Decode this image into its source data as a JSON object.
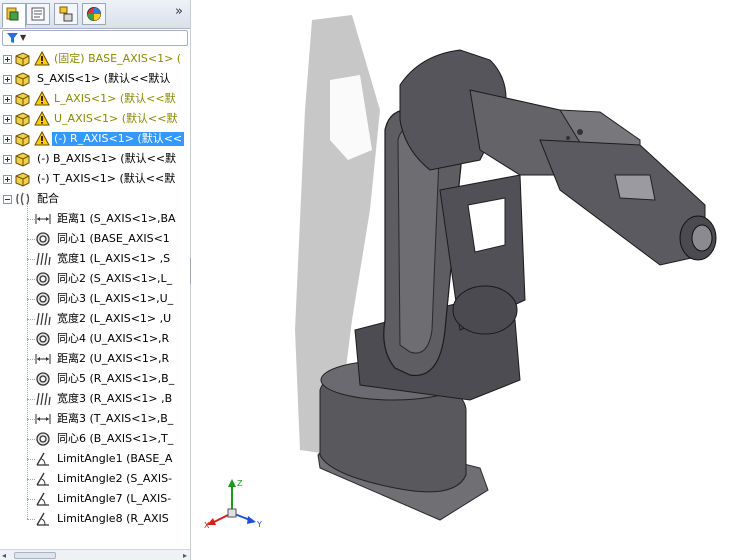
{
  "panel": {
    "tabs": [
      {
        "name": "featuremanager-tab",
        "icon": "featuremanager-tree-icon"
      },
      {
        "name": "propertymanager-tab",
        "icon": "property-sheet-icon"
      },
      {
        "name": "configurationmanager-tab",
        "icon": "configuration-icon"
      },
      {
        "name": "appearance-tab",
        "icon": "display-manager-icon"
      }
    ],
    "collapse_label": "»"
  },
  "tree": {
    "components": [
      {
        "label": "(固定) BASE_AXIS<1> (",
        "style": "olive",
        "selected": false
      },
      {
        "label": "S_AXIS<1> (默认<<默认",
        "style": "normal",
        "selected": false
      },
      {
        "label": "L_AXIS<1> (默认<<默",
        "style": "olive",
        "selected": false
      },
      {
        "label": "U_AXIS<1> (默认<<默",
        "style": "olive",
        "selected": false
      },
      {
        "label": "(-) R_AXIS<1> (默认<<",
        "style": "selected",
        "selected": true
      },
      {
        "label": "(-) B_AXIS<1> (默认<<默",
        "style": "normal",
        "selected": false
      },
      {
        "label": "(-) T_AXIS<1> (默认<<默",
        "style": "normal",
        "selected": false
      }
    ],
    "mates_folder": {
      "label": "配合"
    },
    "mates": [
      {
        "icon": "distance-mate-icon",
        "label": "距离1 (S_AXIS<1>,BA"
      },
      {
        "icon": "concentric-mate-icon",
        "label": "同心1 (BASE_AXIS<1"
      },
      {
        "icon": "width-mate-icon",
        "label": "宽度1 (L_AXIS<1> ,S"
      },
      {
        "icon": "concentric-mate-icon",
        "label": "同心2 (S_AXIS<1>,L_"
      },
      {
        "icon": "concentric-mate-icon",
        "label": "同心3 (L_AXIS<1>,U_"
      },
      {
        "icon": "width-mate-icon",
        "label": "宽度2 (L_AXIS<1> ,U"
      },
      {
        "icon": "concentric-mate-icon",
        "label": "同心4 (U_AXIS<1>,R"
      },
      {
        "icon": "distance-mate-icon",
        "label": "距离2 (U_AXIS<1>,R"
      },
      {
        "icon": "concentric-mate-icon",
        "label": "同心5 (R_AXIS<1>,B_"
      },
      {
        "icon": "width-mate-icon",
        "label": "宽度3 (R_AXIS<1> ,B"
      },
      {
        "icon": "distance-mate-icon",
        "label": "距离3 (T_AXIS<1>,B_"
      },
      {
        "icon": "concentric-mate-icon",
        "label": "同心6 (B_AXIS<1>,T_"
      },
      {
        "icon": "limit-angle-mate-icon",
        "label": "LimitAngle1 (BASE_A"
      },
      {
        "icon": "limit-angle-mate-icon",
        "label": "LimitAngle2 (S_AXIS-"
      },
      {
        "icon": "limit-angle-mate-icon",
        "label": "LimitAngle7 (L_AXIS-"
      },
      {
        "icon": "limit-angle-mate-icon",
        "label": "LimitAngle8 (R_AXIS"
      }
    ]
  },
  "triad": {
    "x_label": "X",
    "y_label": "Y",
    "z_label": "Z"
  },
  "colors": {
    "selection": "#3399ff",
    "warning_text": "#8b8a00",
    "model_gray": "#5a5a5f"
  }
}
